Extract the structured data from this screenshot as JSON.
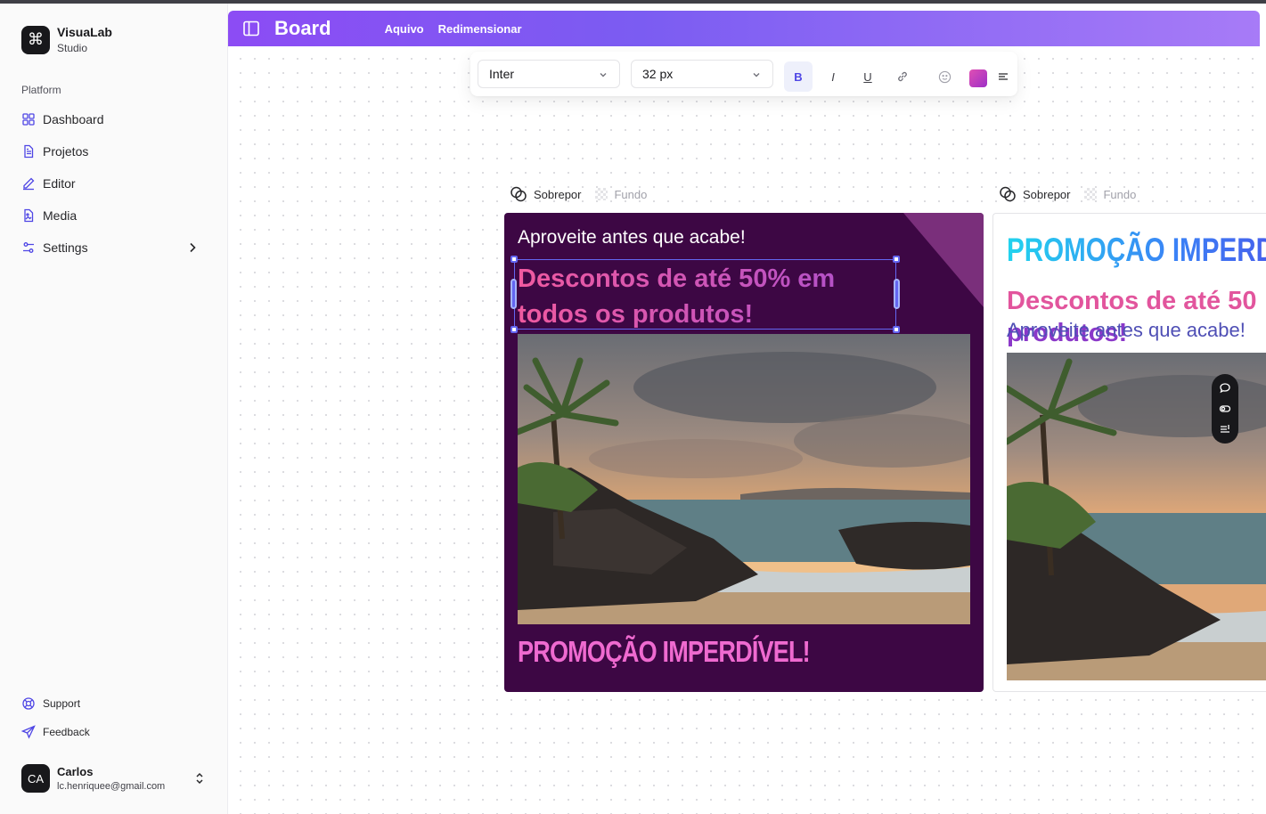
{
  "app": {
    "name": "VisuaLab",
    "subtitle": "Studio",
    "logo_icon": "command-icon"
  },
  "sidebar": {
    "section_label": "Platform",
    "items": [
      {
        "label": "Dashboard",
        "icon": "grid-icon"
      },
      {
        "label": "Projetos",
        "icon": "file-icon"
      },
      {
        "label": "Editor",
        "icon": "pencil-icon"
      },
      {
        "label": "Media",
        "icon": "image-file-icon"
      },
      {
        "label": "Settings",
        "icon": "sliders-icon"
      }
    ],
    "bottom": [
      {
        "label": "Support",
        "icon": "lifebuoy-icon"
      },
      {
        "label": "Feedback",
        "icon": "send-icon"
      }
    ],
    "user": {
      "initials": "CA",
      "name": "Carlos",
      "email": "lc.henriquee@gmail.com"
    }
  },
  "header": {
    "title": "Board",
    "menu": [
      "Aquivo",
      "Redimensionar"
    ],
    "gradient": [
      "#8c4cf4",
      "#a77bf7"
    ]
  },
  "toolbar": {
    "font_family": "Inter",
    "font_size": "32 px",
    "bold": "B",
    "italic": "I",
    "underline": "U",
    "color_swatch": "#d946a8"
  },
  "layer_tabs": {
    "overlay": "Sobrepor",
    "background": "Fundo"
  },
  "canvas": {
    "card1": {
      "background": "#3d0744",
      "tagline": "Aproveite antes que acabe!",
      "headline": "Descontos de até 50% em todos os produtos!",
      "promo": "PROMOÇÃO IMPERDÍVEL!"
    },
    "card2": {
      "promo": "PROMOÇÃO IMPERDÍVEL!",
      "headline_line1": "Descontos de até 50",
      "headline_line2": "produtos!",
      "tagline": "Aproveite antes que acabe!"
    }
  }
}
